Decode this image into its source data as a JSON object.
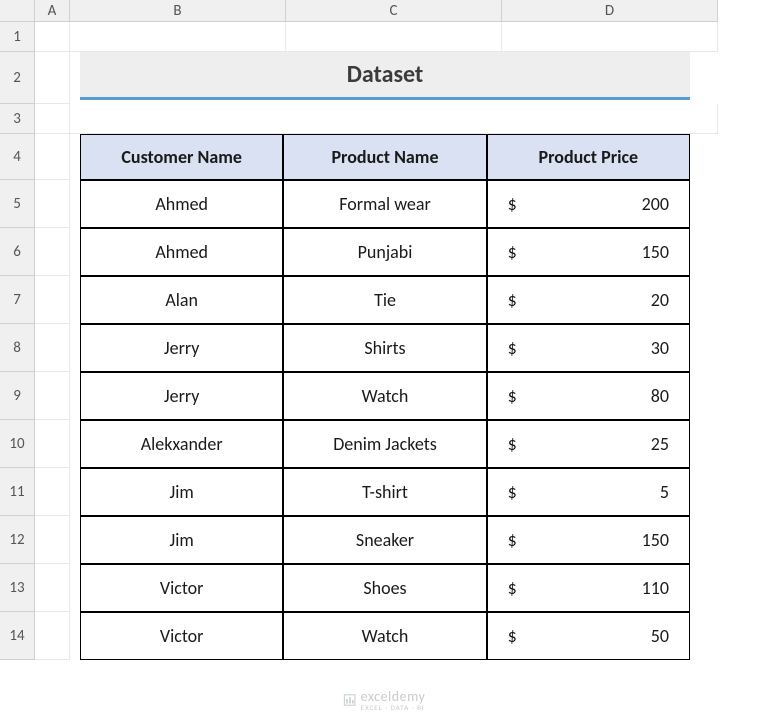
{
  "columns": [
    "",
    "A",
    "B",
    "C",
    "D"
  ],
  "rows": [
    "1",
    "2",
    "3",
    "4",
    "5",
    "6",
    "7",
    "8",
    "9",
    "10",
    "11",
    "12",
    "13",
    "14"
  ],
  "title": "Dataset",
  "table": {
    "headers": [
      "Customer Name",
      "Product Name",
      "Product Price"
    ],
    "currency": "$",
    "data": [
      {
        "customer": "Ahmed",
        "product": "Formal wear",
        "price": 200
      },
      {
        "customer": "Ahmed",
        "product": "Punjabi",
        "price": 150
      },
      {
        "customer": "Alan",
        "product": "Tie",
        "price": 20
      },
      {
        "customer": "Jerry",
        "product": "Shirts",
        "price": 30
      },
      {
        "customer": "Jerry",
        "product": "Watch",
        "price": 80
      },
      {
        "customer": "Alekxander",
        "product": "Denim Jackets",
        "price": 25
      },
      {
        "customer": "Jim",
        "product": "T-shirt",
        "price": 5
      },
      {
        "customer": "Jim",
        "product": "Sneaker",
        "price": 150
      },
      {
        "customer": "Victor",
        "product": "Shoes",
        "price": 110
      },
      {
        "customer": "Victor",
        "product": "Watch",
        "price": 50
      }
    ]
  },
  "watermark": {
    "text": "exceldemy",
    "sub": "EXCEL · DATA · BI"
  },
  "chart_data": {
    "type": "table",
    "title": "Dataset",
    "columns": [
      "Customer Name",
      "Product Name",
      "Product Price"
    ],
    "rows": [
      [
        "Ahmed",
        "Formal wear",
        200
      ],
      [
        "Ahmed",
        "Punjabi",
        150
      ],
      [
        "Alan",
        "Tie",
        20
      ],
      [
        "Jerry",
        "Shirts",
        30
      ],
      [
        "Jerry",
        "Watch",
        80
      ],
      [
        "Alekxander",
        "Denim Jackets",
        25
      ],
      [
        "Jim",
        "T-shirt",
        5
      ],
      [
        "Jim",
        "Sneaker",
        150
      ],
      [
        "Victor",
        "Shoes",
        110
      ],
      [
        "Victor",
        "Watch",
        50
      ]
    ],
    "currency": "$"
  }
}
